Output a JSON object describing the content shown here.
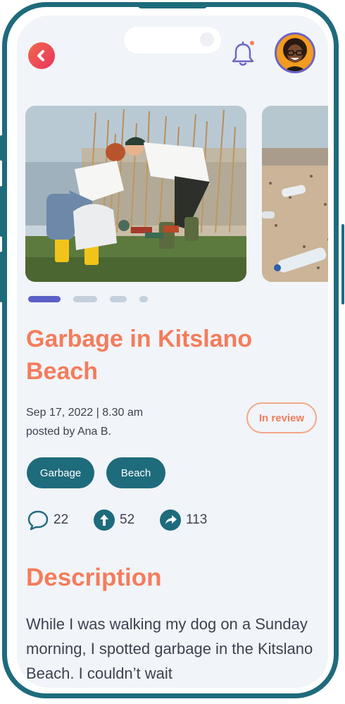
{
  "post": {
    "title": "Garbage in Kitslano Beach",
    "date": "Sep 17, 2022 | 8.30 am",
    "author": "posted by Ana B.",
    "status": "In review",
    "tags": [
      "Garbage",
      "Beach"
    ]
  },
  "stats": {
    "comments": "22",
    "upvotes": "52",
    "shares": "113"
  },
  "carousel": {
    "slide_count": 4,
    "active_index": 0
  },
  "description": {
    "heading": "Description",
    "text": "While I was walking my dog on a Sunday morning, I spotted garbage in the Kitslano Beach. I couldn’t wait"
  },
  "icons": {
    "back": "back-chevron-icon",
    "notifications": "bell-icon",
    "comments": "speech-bubble-icon",
    "upvote": "arrow-up-icon",
    "share": "share-arrow-icon"
  },
  "colors": {
    "accent": "#f47c5c",
    "primary": "#1e6b7c",
    "indicator_active": "#5b5fc7",
    "background": "#f1f4f8"
  }
}
